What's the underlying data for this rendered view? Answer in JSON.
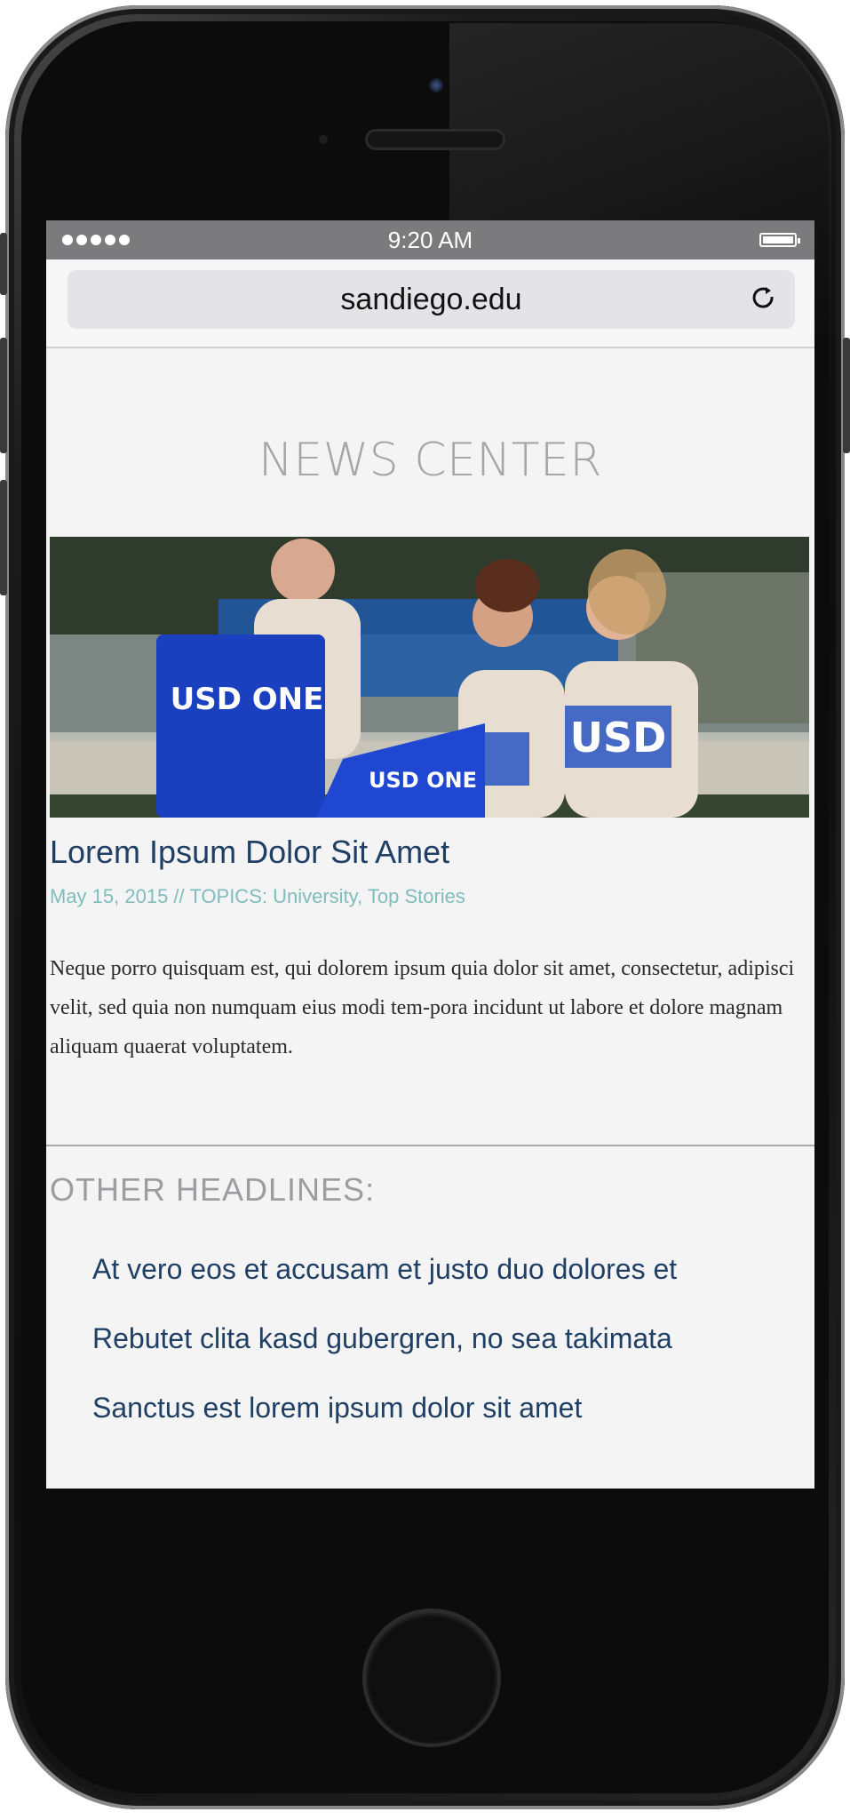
{
  "status_bar": {
    "time": "9:20 AM"
  },
  "browser": {
    "url": "sandiego.edu",
    "reload_icon": "reload-icon"
  },
  "page": {
    "section_title": "NEWS CENTER",
    "featured": {
      "image_text": {
        "bag_large": "USD ONE",
        "bag_small": "USD ONE",
        "shirt": "USD"
      },
      "title": "Lorem Ipsum Dolor Sit Amet",
      "meta": "May 15, 2015 // TOPICS: University, Top Stories",
      "body": "Neque porro quisquam est, qui dolorem ipsum quia dolor sit amet, consectetur, adipisci velit, sed quia non numquam eius modi tem-pora incidunt ut labore et dolore magnam aliquam quaerat voluptatem."
    },
    "other_headlines": {
      "heading": "OTHER HEADLINES:",
      "items": [
        "At vero eos et accusam et justo duo dolores et",
        "Rebutet clita kasd gubergren, no sea takimata",
        "Sanctus est lorem ipsum dolor sit amet"
      ]
    }
  },
  "colors": {
    "headline_blue": "#1f3f64",
    "meta_teal": "#7fbcbc",
    "bag_blue": "#1a3fbf"
  }
}
